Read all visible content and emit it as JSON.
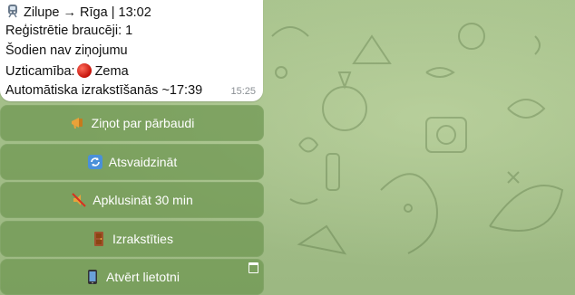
{
  "message": {
    "route": "Zilupe → Rīga | 13:02",
    "registered": "Reģistrētie braucēji: 1",
    "reports": "Šodien nav ziņojumu",
    "reliability_label": "Uzticamība:",
    "reliability_value": "Zema",
    "auto_checkout": "Automātiska izrakstīšanās ~17:39",
    "time": "15:25",
    "icons": {
      "route": "train-icon",
      "reliability": "red-circle-icon"
    }
  },
  "keyboard": [
    {
      "label": "Ziņot par pārbaudi",
      "icon": "megaphone-icon"
    },
    {
      "label": "Atsvaidzināt",
      "icon": "refresh-icon"
    },
    {
      "label": "Apklusināt 30 min",
      "icon": "mute-icon"
    },
    {
      "label": "Izrakstīties",
      "icon": "door-icon"
    },
    {
      "label": "Atvērt lietotni",
      "icon": "phone-icon",
      "corner_icon": "open-app-window-icon"
    }
  ],
  "colors": {
    "bubble": "#ffffff",
    "button": "#6e9650",
    "background": "#9fb883",
    "reliability_dot": "#d01a10"
  }
}
